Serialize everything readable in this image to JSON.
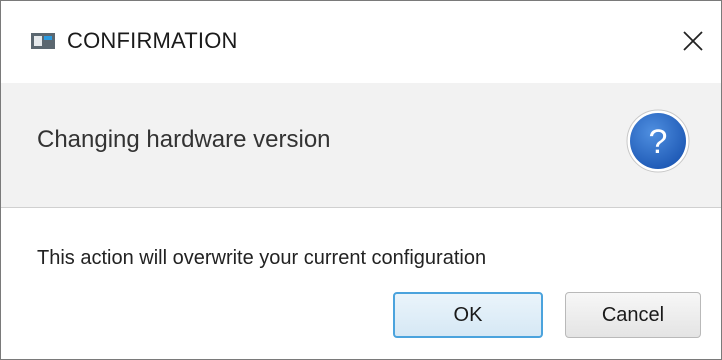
{
  "window": {
    "title": "CONFIRMATION",
    "app_icon": "dialog-app-icon",
    "close_icon": "close-icon"
  },
  "header": {
    "text": "Changing hardware version",
    "icon": "question-icon",
    "icon_color": "#2d6cc9",
    "icon_glyph": "?"
  },
  "content": {
    "message": "This action will overwrite your current configuration"
  },
  "buttons": {
    "ok_label": "OK",
    "cancel_label": "Cancel",
    "default_border_color": "#4ba3dd"
  }
}
